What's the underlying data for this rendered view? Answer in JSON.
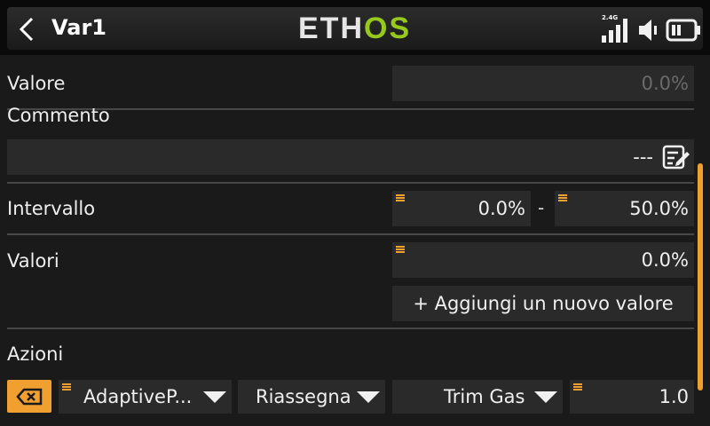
{
  "header": {
    "title": "Var1",
    "logo_part1": "ETH",
    "logo_part2": "OS",
    "signal_label": "2.4G"
  },
  "rows": {
    "valore": {
      "label": "Valore",
      "value": "0.0%"
    },
    "commento": {
      "label": "Commento",
      "value": "---"
    },
    "intervallo": {
      "label": "Intervallo",
      "min": "0.0%",
      "separator": "-",
      "max": "50.0%"
    },
    "valori": {
      "label": "Valori",
      "value": "0.0%",
      "add_button": "+ Aggiungi un nuovo valore"
    },
    "azioni": {
      "label": "Azioni",
      "source": "AdaptiveP...",
      "operation": "Riassegna",
      "target": "Trim Gas",
      "amount": "1.0"
    }
  },
  "colors": {
    "accent": "#f0a030",
    "logo_green": "#96c81e",
    "background": "#1a1a1a",
    "field": "#2a2a2a"
  },
  "icons": [
    "back-arrow-icon",
    "signal-icon",
    "speaker-icon",
    "battery-icon",
    "edit-icon",
    "delete-icon",
    "menu-mark-icon",
    "dropdown-arrow-icon"
  ]
}
